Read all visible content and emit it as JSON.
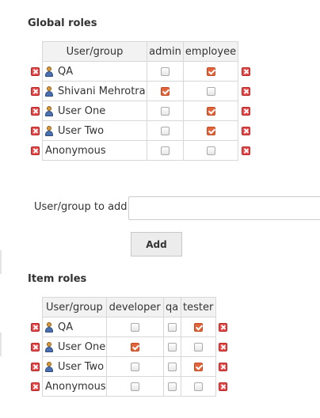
{
  "global_roles": {
    "title": "Global roles",
    "columns": [
      "User/group",
      "admin",
      "employee"
    ],
    "rows": [
      {
        "name": "QA",
        "type": "user",
        "checks": [
          false,
          true
        ]
      },
      {
        "name": "Shivani Mehrotra",
        "type": "user",
        "checks": [
          true,
          false
        ]
      },
      {
        "name": "User One",
        "type": "user",
        "checks": [
          false,
          true
        ]
      },
      {
        "name": "User Two",
        "type": "user",
        "checks": [
          false,
          true
        ]
      },
      {
        "name": "Anonymous",
        "type": "anonymous",
        "checks": [
          false,
          false
        ]
      }
    ]
  },
  "add_user": {
    "label": "User/group to add",
    "value": "",
    "button": "Add"
  },
  "item_roles": {
    "title": "Item roles",
    "columns": [
      "User/group",
      "developer",
      "qa",
      "tester"
    ],
    "rows": [
      {
        "name": "QA",
        "type": "user",
        "checks": [
          false,
          false,
          true
        ]
      },
      {
        "name": "User One",
        "type": "user",
        "checks": [
          true,
          false,
          false
        ]
      },
      {
        "name": "User Two",
        "type": "user",
        "checks": [
          false,
          false,
          true
        ]
      },
      {
        "name": "Anonymous",
        "type": "anonymous",
        "checks": [
          false,
          false,
          false
        ]
      }
    ]
  },
  "colors": {
    "checked": "#e3643a",
    "delete": "#e34a4a"
  },
  "icons": {
    "delete": "delete-icon",
    "user": "user-icon"
  }
}
